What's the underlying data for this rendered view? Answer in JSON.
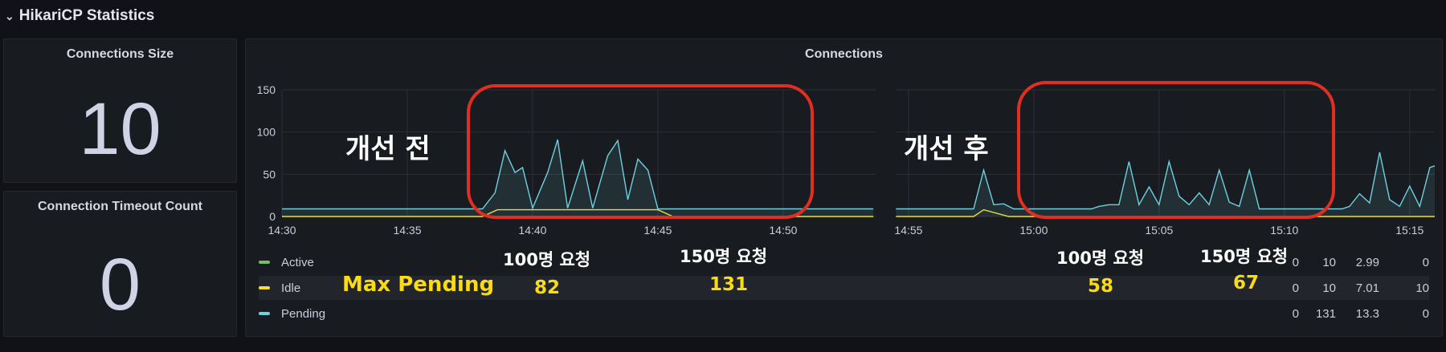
{
  "row": {
    "title": "HikariCP Statistics",
    "collapse_icon": "chevron-down-icon"
  },
  "stat_size": {
    "title": "Connections Size",
    "value": "10"
  },
  "stat_timeout": {
    "title": "Connection Timeout Count",
    "value": "0"
  },
  "connections": {
    "title": "Connections",
    "legend": [
      {
        "name": "Active",
        "color": "#73bf69",
        "min": "0",
        "max": "10",
        "mean": "2.99",
        "last": "0"
      },
      {
        "name": "Idle",
        "color": "#fade2a",
        "min": "0",
        "max": "10",
        "mean": "7.01",
        "last": "10"
      },
      {
        "name": "Pending",
        "color": "#6ed0e0",
        "min": "0",
        "max": "131",
        "mean": "13.3",
        "last": "0"
      }
    ]
  },
  "annotations": {
    "before": "개선 전",
    "after": "개선 후",
    "max_pending": "Max Pending",
    "req_100_a": "100명 요청",
    "req_150_a": "150명 요청",
    "req_100_b": "100명 요청",
    "req_150_b": "150명 요청",
    "val_82": "82",
    "val_131": "131",
    "val_58": "58",
    "val_67": "67",
    "highlight_color": "#e02f22"
  },
  "chart_data": {
    "type": "line",
    "title": "Connections",
    "x_ticks": [
      "14:30",
      "14:35",
      "14:40",
      "14:45",
      "14:50",
      "14:55",
      "15:00",
      "15:05",
      "15:10",
      "15:15"
    ],
    "y_ticks": [
      "0",
      "50",
      "100",
      "150"
    ],
    "ylim": [
      0,
      150
    ],
    "xlim_minutes": [
      0,
      46
    ],
    "gap_minutes": [
      23.7,
      24.5
    ],
    "series": [
      {
        "name": "Pending",
        "color": "#6ed0e0",
        "fill": true,
        "points": [
          [
            0,
            9
          ],
          [
            8,
            9
          ],
          [
            8.5,
            28
          ],
          [
            8.9,
            78
          ],
          [
            9.3,
            52
          ],
          [
            9.6,
            58
          ],
          [
            10,
            10
          ],
          [
            10.6,
            52
          ],
          [
            11,
            91
          ],
          [
            11.4,
            10
          ],
          [
            12,
            66
          ],
          [
            12.4,
            10
          ],
          [
            13,
            72
          ],
          [
            13.4,
            90
          ],
          [
            13.8,
            20
          ],
          [
            14.2,
            68
          ],
          [
            14.6,
            55
          ],
          [
            15,
            9
          ],
          [
            23.5,
            9
          ],
          [
            23.6,
            9
          ],
          [
            24.5,
            9
          ],
          [
            27.6,
            9
          ],
          [
            28,
            55
          ],
          [
            28.4,
            14
          ],
          [
            28.8,
            15
          ],
          [
            29.2,
            9
          ],
          [
            32.3,
            9
          ],
          [
            32.6,
            12
          ],
          [
            33,
            14
          ],
          [
            33.4,
            14
          ],
          [
            33.8,
            65
          ],
          [
            34.2,
            14
          ],
          [
            34.6,
            35
          ],
          [
            35,
            14
          ],
          [
            35.4,
            65
          ],
          [
            35.8,
            24
          ],
          [
            36.2,
            14
          ],
          [
            36.6,
            28
          ],
          [
            37,
            14
          ],
          [
            37.4,
            55
          ],
          [
            37.8,
            17
          ],
          [
            38.2,
            12
          ],
          [
            38.6,
            55
          ],
          [
            39,
            9
          ],
          [
            42.3,
            9
          ],
          [
            42.6,
            12
          ],
          [
            43,
            27
          ],
          [
            43.4,
            16
          ],
          [
            43.8,
            76
          ],
          [
            44.2,
            20
          ],
          [
            44.6,
            12
          ],
          [
            45,
            36
          ],
          [
            45.4,
            12
          ],
          [
            45.8,
            58
          ],
          [
            46,
            60
          ]
        ]
      },
      {
        "name": "Idle",
        "color": "#fade2a",
        "fill": false,
        "points": [
          [
            0,
            0
          ],
          [
            8,
            0
          ],
          [
            8.6,
            8
          ],
          [
            15,
            8
          ],
          [
            15.6,
            0
          ],
          [
            23.6,
            0
          ],
          [
            24.5,
            0
          ],
          [
            27.6,
            0
          ],
          [
            28,
            8
          ],
          [
            29,
            0
          ],
          [
            46,
            0
          ]
        ]
      },
      {
        "name": "Active",
        "color": "#73bf69",
        "fill": false,
        "points": [
          [
            0,
            0
          ],
          [
            46,
            0
          ]
        ]
      }
    ]
  }
}
